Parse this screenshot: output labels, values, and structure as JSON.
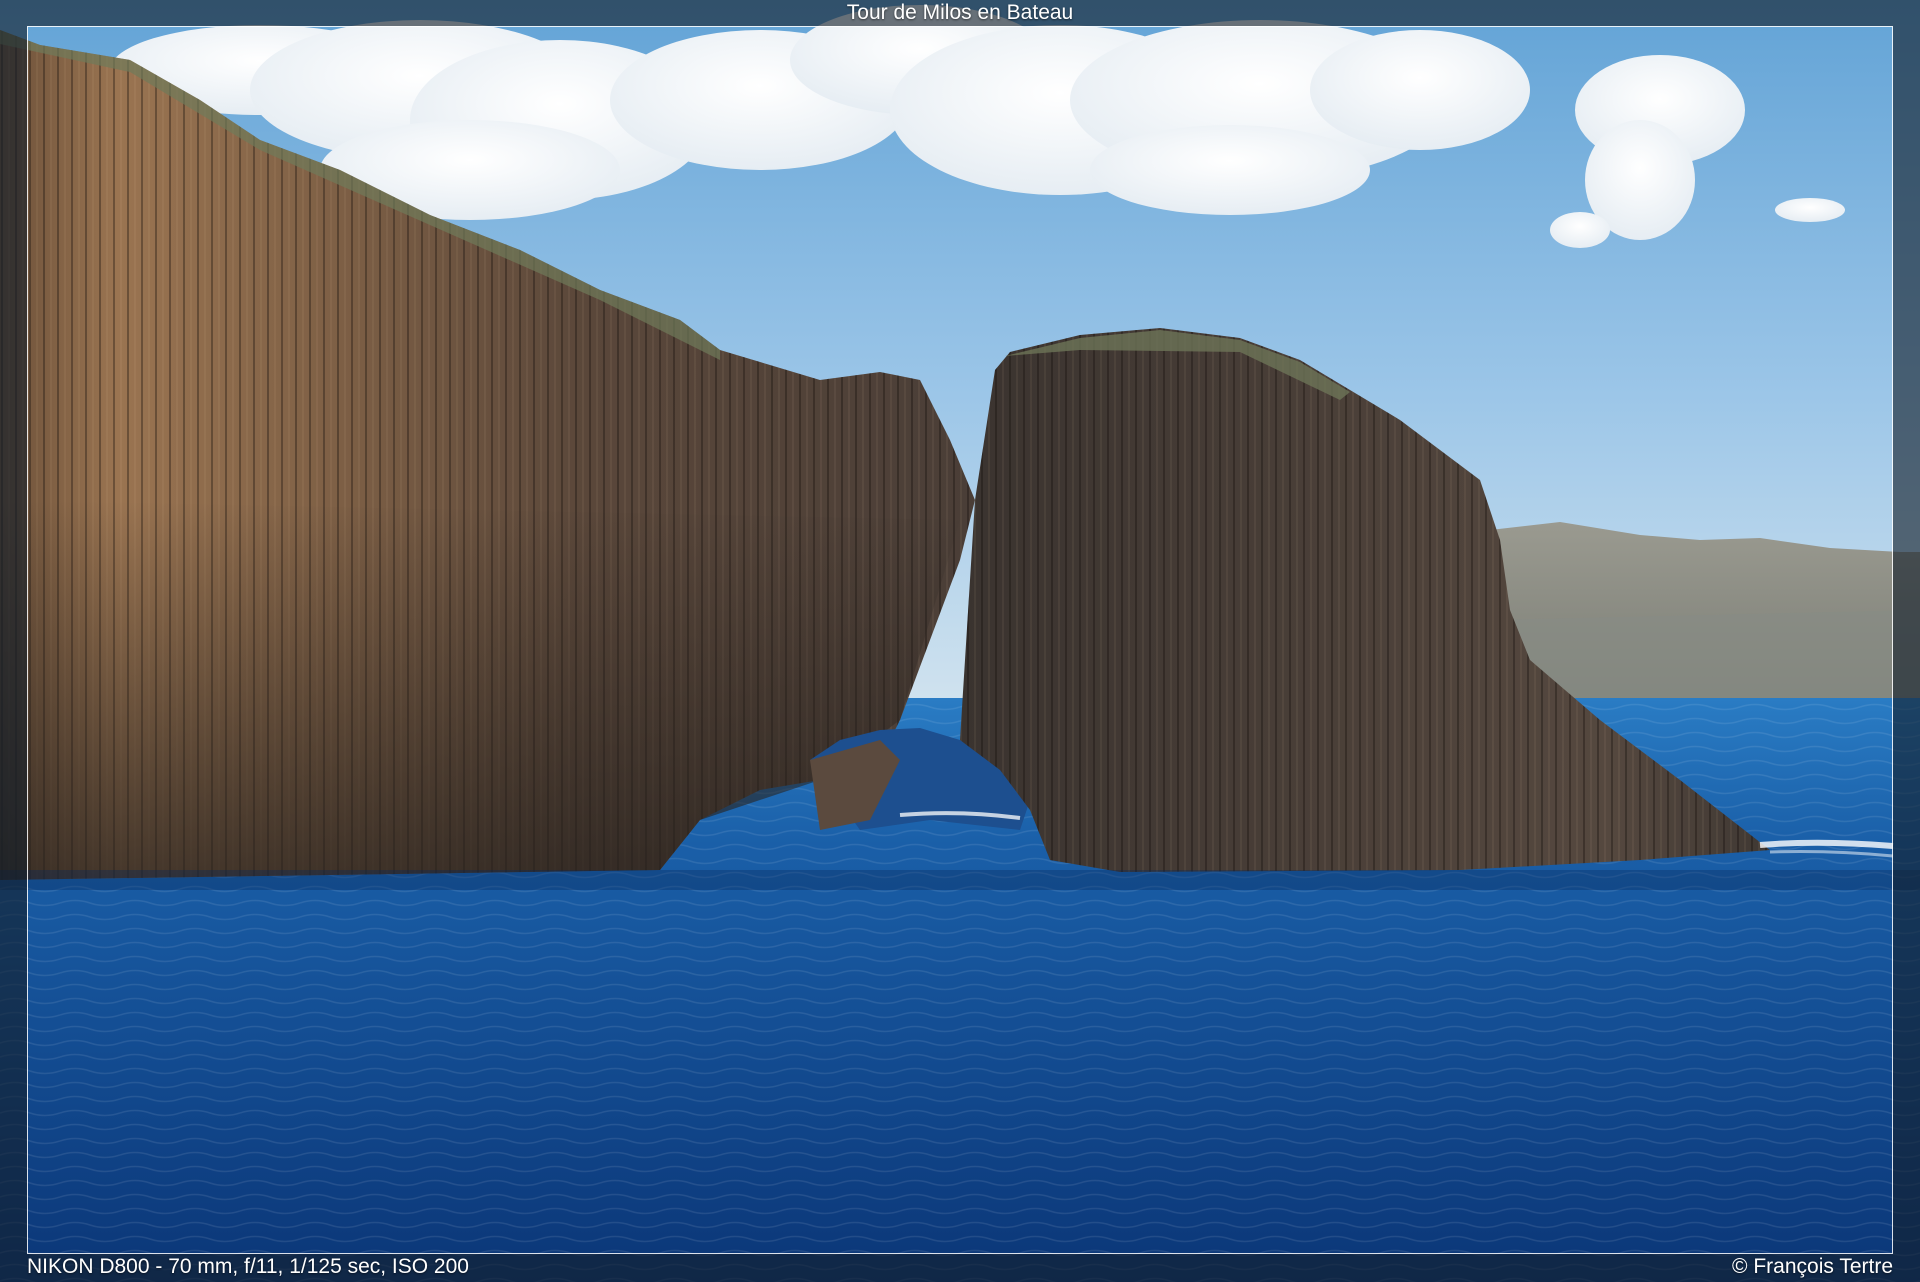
{
  "viewer": {
    "title": "Tour de Milos en Bateau",
    "exif": "NIKON D800 - 70 mm, f/11, 1/125 sec, ISO 200",
    "credit": "© François Tertre"
  },
  "photo": {
    "subject": "basalt-sea-arch",
    "colors": {
      "sky_top": "#6fa9d8",
      "sky_bottom": "#c9def0",
      "cloud": "#ffffff",
      "rock_lit": "#8a6a4a",
      "rock_shadow": "#3d3733",
      "sea_far": "#1f6fb8",
      "sea_near": "#0e3f86",
      "hill": "#8e8f86"
    }
  }
}
